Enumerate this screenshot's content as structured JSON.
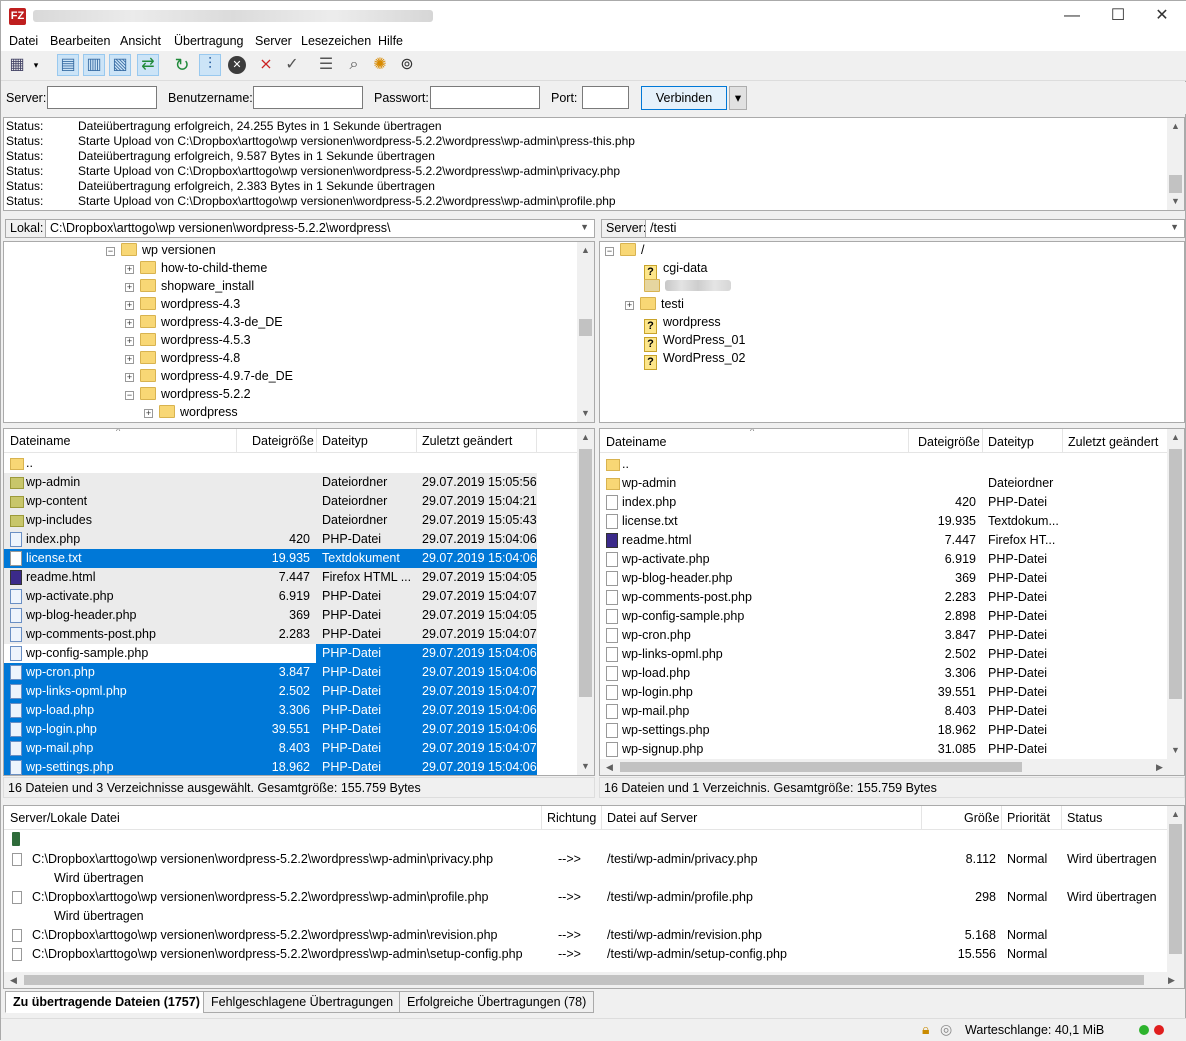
{
  "window": {
    "title_icon": "FZ",
    "minimize": "—",
    "maximize": "☐",
    "close": "✕"
  },
  "menu": [
    "Datei",
    "Bearbeiten",
    "Ansicht",
    "Übertragung",
    "Server",
    "Lesezeichen",
    "Hilfe"
  ],
  "quickconnect": {
    "server_label": "Server:",
    "user_label": "Benutzername:",
    "pass_label": "Passwort:",
    "port_label": "Port:",
    "connect_label": "Verbinden",
    "dropdown": "▾"
  },
  "log": [
    {
      "k": "Status:",
      "m": "Dateiübertragung erfolgreich, 24.255 Bytes in 1 Sekunde übertragen"
    },
    {
      "k": "Status:",
      "m": "Starte Upload von C:\\Dropbox\\arttogo\\wp versionen\\wordpress-5.2.2\\wordpress\\wp-admin\\press-this.php"
    },
    {
      "k": "Status:",
      "m": "Dateiübertragung erfolgreich, 9.587 Bytes in 1 Sekunde übertragen"
    },
    {
      "k": "Status:",
      "m": "Starte Upload von C:\\Dropbox\\arttogo\\wp versionen\\wordpress-5.2.2\\wordpress\\wp-admin\\privacy.php"
    },
    {
      "k": "Status:",
      "m": "Dateiübertragung erfolgreich, 2.383 Bytes in 1 Sekunde übertragen"
    },
    {
      "k": "Status:",
      "m": "Starte Upload von C:\\Dropbox\\arttogo\\wp versionen\\wordpress-5.2.2\\wordpress\\wp-admin\\profile.php"
    }
  ],
  "local": {
    "label": "Lokal:",
    "path": "C:\\Dropbox\\arttogo\\wp versionen\\wordpress-5.2.2\\wordpress\\",
    "tree": [
      "wp versionen",
      "how-to-child-theme",
      "shopware_install",
      "wordpress-4.3",
      "wordpress-4.3-de_DE",
      "wordpress-4.5.3",
      "wordpress-4.8",
      "wordpress-4.9.7-de_DE",
      "wordpress-5.2.2",
      "wordpress"
    ],
    "headers": [
      "Dateiname",
      "Dateigröße",
      "Dateityp",
      "Zuletzt geändert"
    ],
    "files": [
      {
        "name": "..",
        "size": "",
        "type": "",
        "date": ""
      },
      {
        "name": "wp-admin",
        "size": "",
        "type": "Dateiordner",
        "date": "29.07.2019 15:05:56"
      },
      {
        "name": "wp-content",
        "size": "",
        "type": "Dateiordner",
        "date": "29.07.2019 15:04:21"
      },
      {
        "name": "wp-includes",
        "size": "",
        "type": "Dateiordner",
        "date": "29.07.2019 15:05:43"
      },
      {
        "name": "index.php",
        "size": "420",
        "type": "PHP-Datei",
        "date": "29.07.2019 15:04:06"
      },
      {
        "name": "license.txt",
        "size": "19.935",
        "type": "Textdokument",
        "date": "29.07.2019 15:04:06"
      },
      {
        "name": "readme.html",
        "size": "7.447",
        "type": "Firefox HTML ...",
        "date": "29.07.2019 15:04:05"
      },
      {
        "name": "wp-activate.php",
        "size": "6.919",
        "type": "PHP-Datei",
        "date": "29.07.2019 15:04:07"
      },
      {
        "name": "wp-blog-header.php",
        "size": "369",
        "type": "PHP-Datei",
        "date": "29.07.2019 15:04:05"
      },
      {
        "name": "wp-comments-post.php",
        "size": "2.283",
        "type": "PHP-Datei",
        "date": "29.07.2019 15:04:07"
      },
      {
        "name": "wp-config-sample.php",
        "size": "",
        "type": "PHP-Datei",
        "date": "29.07.2019 15:04:06"
      },
      {
        "name": "wp-cron.php",
        "size": "3.847",
        "type": "PHP-Datei",
        "date": "29.07.2019 15:04:06"
      },
      {
        "name": "wp-links-opml.php",
        "size": "2.502",
        "type": "PHP-Datei",
        "date": "29.07.2019 15:04:07"
      },
      {
        "name": "wp-load.php",
        "size": "3.306",
        "type": "PHP-Datei",
        "date": "29.07.2019 15:04:06"
      },
      {
        "name": "wp-login.php",
        "size": "39.551",
        "type": "PHP-Datei",
        "date": "29.07.2019 15:04:06"
      },
      {
        "name": "wp-mail.php",
        "size": "8.403",
        "type": "PHP-Datei",
        "date": "29.07.2019 15:04:07"
      },
      {
        "name": "wp-settings.php",
        "size": "18.962",
        "type": "PHP-Datei",
        "date": "29.07.2019 15:04:06"
      }
    ],
    "status": "16 Dateien und 3 Verzeichnisse ausgewählt. Gesamtgröße: 155.759 Bytes"
  },
  "remote": {
    "label": "Server:",
    "path": "/testi",
    "tree": [
      "/",
      "cgi-data",
      "testi",
      "wordpress",
      "WordPress_01",
      "WordPress_02"
    ],
    "headers": [
      "Dateiname",
      "Dateigröße",
      "Dateityp",
      "Zuletzt geändert"
    ],
    "files": [
      {
        "name": "..",
        "size": "",
        "type": ""
      },
      {
        "name": "wp-admin",
        "size": "",
        "type": "Dateiordner"
      },
      {
        "name": "index.php",
        "size": "420",
        "type": "PHP-Datei"
      },
      {
        "name": "license.txt",
        "size": "19.935",
        "type": "Textdokum..."
      },
      {
        "name": "readme.html",
        "size": "7.447",
        "type": "Firefox HT..."
      },
      {
        "name": "wp-activate.php",
        "size": "6.919",
        "type": "PHP-Datei"
      },
      {
        "name": "wp-blog-header.php",
        "size": "369",
        "type": "PHP-Datei"
      },
      {
        "name": "wp-comments-post.php",
        "size": "2.283",
        "type": "PHP-Datei"
      },
      {
        "name": "wp-config-sample.php",
        "size": "2.898",
        "type": "PHP-Datei"
      },
      {
        "name": "wp-cron.php",
        "size": "3.847",
        "type": "PHP-Datei"
      },
      {
        "name": "wp-links-opml.php",
        "size": "2.502",
        "type": "PHP-Datei"
      },
      {
        "name": "wp-load.php",
        "size": "3.306",
        "type": "PHP-Datei"
      },
      {
        "name": "wp-login.php",
        "size": "39.551",
        "type": "PHP-Datei"
      },
      {
        "name": "wp-mail.php",
        "size": "8.403",
        "type": "PHP-Datei"
      },
      {
        "name": "wp-settings.php",
        "size": "18.962",
        "type": "PHP-Datei"
      },
      {
        "name": "wp-signup.php",
        "size": "31.085",
        "type": "PHP-Datei"
      }
    ],
    "status": "16 Dateien und 1 Verzeichnis. Gesamtgröße: 155.759 Bytes"
  },
  "queue": {
    "headers": [
      "Server/Lokale Datei",
      "Richtung",
      "Datei auf Server",
      "Größe",
      "Priorität",
      "Status"
    ],
    "rows": [
      {
        "local": "C:\\Dropbox\\arttogo\\wp versionen\\wordpress-5.2.2\\wordpress\\wp-admin\\privacy.php",
        "dir": "-->>",
        "remote": "/testi/wp-admin/privacy.php",
        "size": "8.112",
        "prio": "Normal",
        "status": "Wird übertragen",
        "sub": "Wird übertragen"
      },
      {
        "local": "C:\\Dropbox\\arttogo\\wp versionen\\wordpress-5.2.2\\wordpress\\wp-admin\\profile.php",
        "dir": "-->>",
        "remote": "/testi/wp-admin/profile.php",
        "size": "298",
        "prio": "Normal",
        "status": "Wird übertragen",
        "sub": "Wird übertragen"
      },
      {
        "local": "C:\\Dropbox\\arttogo\\wp versionen\\wordpress-5.2.2\\wordpress\\wp-admin\\revision.php",
        "dir": "-->>",
        "remote": "/testi/wp-admin/revision.php",
        "size": "5.168",
        "prio": "Normal",
        "status": "",
        "sub": ""
      },
      {
        "local": "C:\\Dropbox\\arttogo\\wp versionen\\wordpress-5.2.2\\wordpress\\wp-admin\\setup-config.php",
        "dir": "-->>",
        "remote": "/testi/wp-admin/setup-config.php",
        "size": "15.556",
        "prio": "Normal",
        "status": "",
        "sub": ""
      }
    ]
  },
  "tabs": [
    "Zu übertragende Dateien (1757)",
    "Fehlgeschlagene Übertragungen",
    "Erfolgreiche Übertragungen (78)"
  ],
  "statusbar": {
    "queue": "Warteschlange: 40,1 MiB"
  },
  "colors": {
    "selection": "#0078d7",
    "accent": "#0078d7",
    "folder": "#f8d775"
  }
}
